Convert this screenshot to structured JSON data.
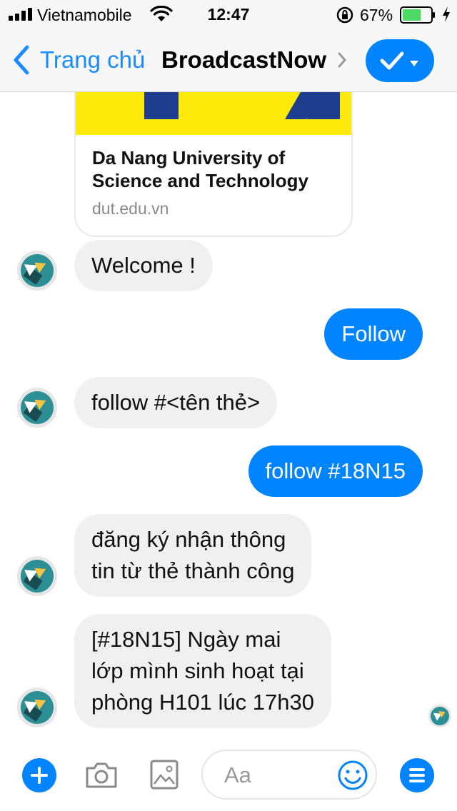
{
  "status_bar": {
    "carrier": "Vietnamobile",
    "time": "12:47",
    "battery_percent": "67%",
    "signal_bars": 4,
    "battery_level": 0.67
  },
  "nav": {
    "back_label": "Trang chủ",
    "title": "BroadcastNow",
    "accent_color": "#0084ff"
  },
  "link_card": {
    "title": "Da Nang University of Science and Technology",
    "url": "dut.edu.vn"
  },
  "messages": [
    {
      "direction": "in",
      "text": "Welcome !"
    },
    {
      "direction": "out",
      "text": "Follow"
    },
    {
      "direction": "in",
      "text": "follow #<tên thẻ>"
    },
    {
      "direction": "out",
      "text": "follow #18N15"
    },
    {
      "direction": "in",
      "lines": [
        "đăng ký nhận thông",
        "tin từ thẻ thành công"
      ]
    },
    {
      "direction": "in",
      "lines": [
        "[#18N15] Ngày mai",
        "lớp mình sinh hoạt tại",
        "phòng H101 lúc 17h30"
      ]
    }
  ],
  "composer": {
    "placeholder": "Aa",
    "icons": [
      "plus-icon",
      "camera-icon",
      "image-icon",
      "emoji-icon",
      "menu-icon"
    ]
  }
}
